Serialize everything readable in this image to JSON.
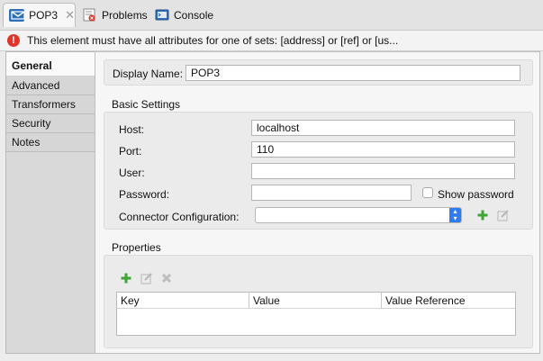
{
  "tabs": [
    {
      "label": "POP3",
      "icon": "envelope-icon",
      "active": true
    },
    {
      "label": "Problems",
      "icon": "problems-icon"
    },
    {
      "label": "Console",
      "icon": "console-icon"
    }
  ],
  "error_message": "This element must have all attributes for one of sets: [address] or [ref] or [us...",
  "sidebar": {
    "items": [
      {
        "label": "General"
      },
      {
        "label": "Advanced"
      },
      {
        "label": "Transformers"
      },
      {
        "label": "Security"
      },
      {
        "label": "Notes"
      }
    ]
  },
  "form": {
    "display_name_label": "Display Name:",
    "display_name_value": "POP3",
    "basic_settings_title": "Basic Settings",
    "host_label": "Host:",
    "host_value": "localhost",
    "port_label": "Port:",
    "port_value": "110",
    "user_label": "User:",
    "user_value": "",
    "password_label": "Password:",
    "password_value": "",
    "show_password_label": "Show password",
    "connector_label": "Connector Configuration:",
    "connector_value": ""
  },
  "properties": {
    "title": "Properties",
    "columns": [
      "Key",
      "Value",
      "Value Reference"
    ]
  },
  "colors": {
    "error_red": "#e0352b",
    "add_green": "#3fa535",
    "select_blue": "#2e7cf0",
    "tab_icon_blue": "#2d6fb8"
  }
}
